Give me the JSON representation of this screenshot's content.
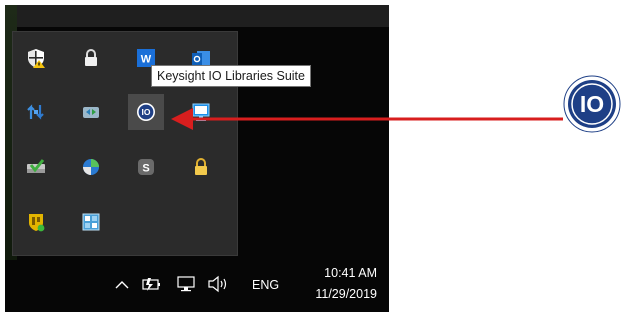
{
  "tooltip": {
    "text": "Keysight IO Libraries Suite"
  },
  "tray_icons": [
    {
      "name": "windows-security-warning-icon"
    },
    {
      "name": "lock-icon"
    },
    {
      "name": "w-app-icon"
    },
    {
      "name": "outlook-icon"
    },
    {
      "name": "bluetooth-transfer-icon"
    },
    {
      "name": "network-sync-icon"
    },
    {
      "name": "keysight-io-icon",
      "label": "IO"
    },
    {
      "name": "remote-desktop-icon"
    },
    {
      "name": "drive-check-icon"
    },
    {
      "name": "globe-sync-icon"
    },
    {
      "name": "skype-icon",
      "label": "S"
    },
    {
      "name": "yellow-lock-icon"
    },
    {
      "name": "shield-badge-icon"
    },
    {
      "name": "app-grid-icon"
    }
  ],
  "taskbar": {
    "language": "ENG",
    "time": "10:41 AM",
    "date": "11/29/2019",
    "system_icons": [
      "chevron-up-icon",
      "battery-icon",
      "network-icon",
      "volume-icon"
    ]
  },
  "callout": {
    "large_icon_label": "IO",
    "arrow_color": "#d81e1e"
  },
  "colors": {
    "tooltip_bg": "#ffffff",
    "panel_bg": "#2b2b2b",
    "taskbar_bg": "#060606",
    "io_blue": "#1e3f86"
  }
}
